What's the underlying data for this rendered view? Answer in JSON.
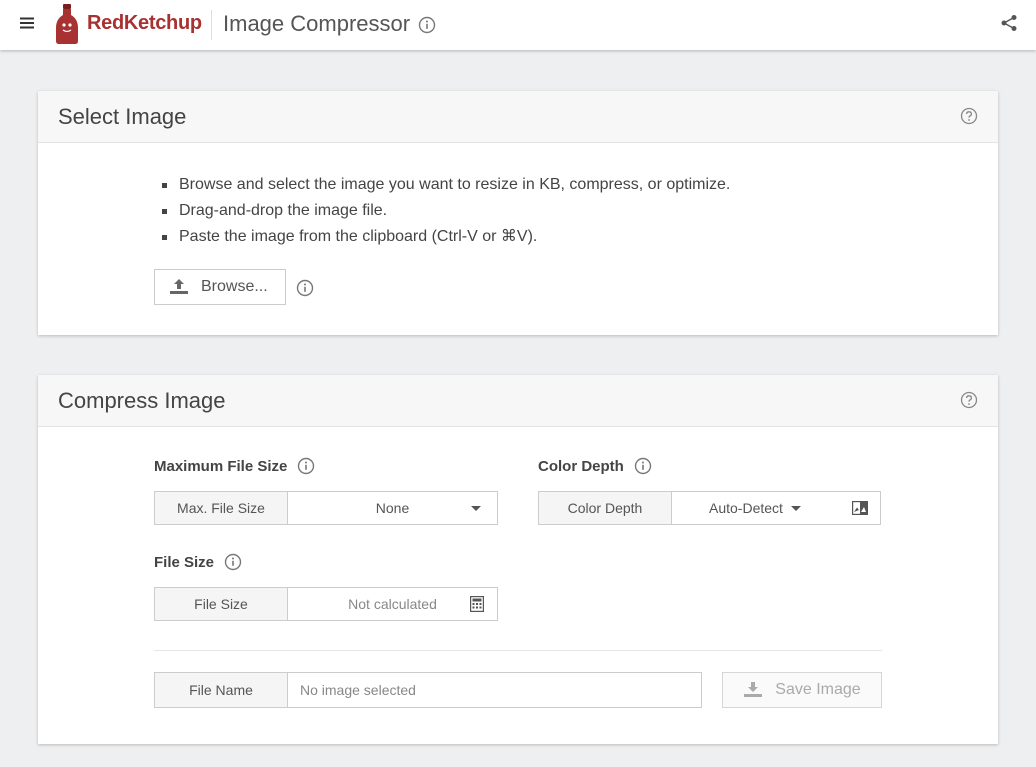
{
  "header": {
    "brand": "RedKetchup",
    "app_title": "Image Compressor"
  },
  "select_card": {
    "title": "Select Image",
    "bullets": [
      "Browse and select the image you want to resize in KB, compress, or optimize.",
      "Drag-and-drop the image file.",
      "Paste the image from the clipboard (Ctrl-V or ⌘V)."
    ],
    "browse_label": "Browse..."
  },
  "compress_card": {
    "title": "Compress Image",
    "max_file_size": {
      "label": "Maximum File Size",
      "addon": "Max. File Size",
      "value": "None"
    },
    "color_depth": {
      "label": "Color Depth",
      "addon": "Color Depth",
      "value": "Auto-Detect"
    },
    "file_size": {
      "label": "File Size",
      "addon": "File Size",
      "placeholder": "Not calculated"
    },
    "file_name": {
      "addon": "File Name",
      "placeholder": "No image selected"
    },
    "save_label": "Save Image"
  },
  "colors": {
    "brand": "#a83232",
    "page_bg": "#eeeff0",
    "card_header_bg": "#f7f7f7"
  },
  "icons": [
    "menu-icon",
    "ketchup-bottle-logo",
    "info-icon",
    "share-icon",
    "help-circle-icon",
    "upload-icon",
    "calculator-icon",
    "image-toggle-icon",
    "download-icon"
  ]
}
